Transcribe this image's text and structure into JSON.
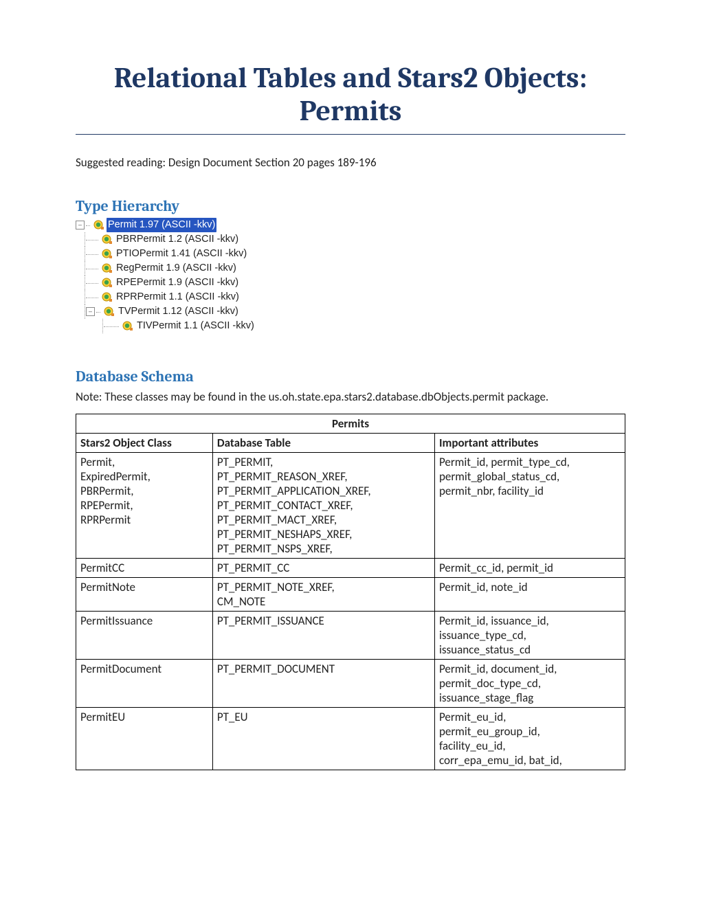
{
  "title": "Relational Tables and Stars2 Objects: Permits",
  "suggested_reading": "Suggested reading:  Design Document Section 20 pages 189-196",
  "sections": {
    "type_hierarchy_heading": "Type Hierarchy",
    "database_schema_heading": "Database Schema",
    "schema_note": "Note: These classes may be found in the us.oh.state.epa.stars2.database.dbObjects.permit package."
  },
  "tree": {
    "root": "Permit 1.97 (ASCII -kkv)",
    "children": [
      "PBRPermit 1.2 (ASCII -kkv)",
      "PTIOPermit 1.41 (ASCII -kkv)",
      "RegPermit 1.9 (ASCII -kkv)",
      "RPEPermit 1.9 (ASCII -kkv)",
      "RPRPermit 1.1 (ASCII -kkv)",
      "TVPermit 1.12 (ASCII -kkv)"
    ],
    "grandchild": "TIVPermit 1.1 (ASCII -kkv)"
  },
  "table": {
    "caption": "Permits",
    "headers": [
      "Stars2 Object Class",
      "Database Table",
      "Important attributes"
    ],
    "rows": [
      {
        "class": "Permit,\nExpiredPermit,\nPBRPermit,\nRPEPermit,\nRPRPermit",
        "db": "PT_PERMIT,\nPT_PERMIT_REASON_XREF,\nPT_PERMIT_APPLICATION_XREF,\nPT_PERMIT_CONTACT_XREF,\nPT_PERMIT_MACT_XREF,\nPT_PERMIT_NESHAPS_XREF,\nPT_PERMIT_NSPS_XREF,",
        "attrs": "Permit_id, permit_type_cd,\npermit_global_status_cd,\npermit_nbr, facility_id"
      },
      {
        "class": "PermitCC",
        "db": "PT_PERMIT_CC",
        "attrs": "Permit_cc_id, permit_id"
      },
      {
        "class": "PermitNote",
        "db": "PT_PERMIT_NOTE_XREF,\nCM_NOTE",
        "attrs": "Permit_id, note_id"
      },
      {
        "class": "PermitIssuance",
        "db": "PT_PERMIT_ISSUANCE",
        "attrs": "Permit_id, issuance_id,\nissuance_type_cd,\nissuance_status_cd"
      },
      {
        "class": "PermitDocument",
        "db": "PT_PERMIT_DOCUMENT",
        "attrs": "Permit_id, document_id,\npermit_doc_type_cd,\nissuance_stage_flag"
      },
      {
        "class": "PermitEU",
        "db": "PT_EU",
        "attrs": "Permit_eu_id,\npermit_eu_group_id,\nfacility_eu_id,\ncorr_epa_emu_id, bat_id,"
      }
    ]
  }
}
